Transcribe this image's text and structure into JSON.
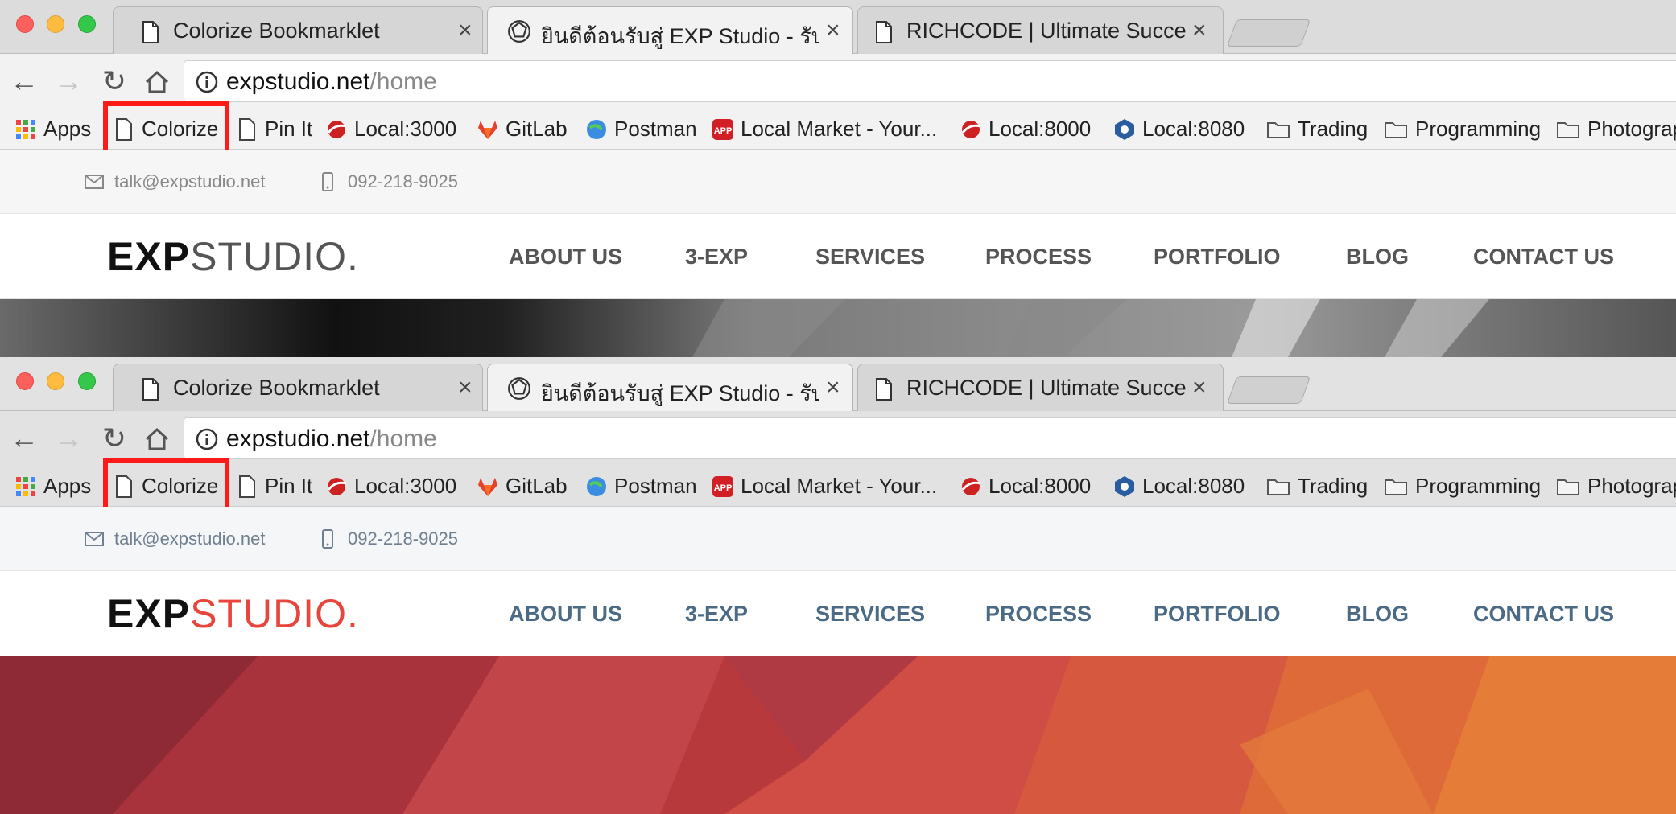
{
  "screens": {
    "a": {
      "tabs": [
        {
          "title": "Colorize Bookmarklet",
          "close": "×"
        },
        {
          "title": "ยินดีต้อนรับสู่ EXP Studio - รับทำเ",
          "close": "×"
        },
        {
          "title": "RICHCODE | Ultimate Success",
          "close": "×"
        }
      ],
      "url": {
        "host": "expstudio.net",
        "path": "/home"
      },
      "bookmarks": [
        {
          "label": "Apps",
          "icon": "apps-grid-icon"
        },
        {
          "label": "Colorize",
          "icon": "page-icon"
        },
        {
          "label": "Pin It",
          "icon": "page-icon"
        },
        {
          "label": "Local:3000",
          "icon": "rails-icon"
        },
        {
          "label": "GitLab",
          "icon": "gitlab-icon"
        },
        {
          "label": "Postman",
          "icon": "postman-icon"
        },
        {
          "label": "Local Market - Your...",
          "icon": "app-icon"
        },
        {
          "label": "Local:8000",
          "icon": "rails-icon"
        },
        {
          "label": "Local:8080",
          "icon": "hexagon-icon"
        },
        {
          "label": "Trading",
          "icon": "folder-icon"
        },
        {
          "label": "Programming",
          "icon": "folder-icon"
        },
        {
          "label": "Photograp",
          "icon": "folder-icon"
        }
      ],
      "contact": {
        "email": "talk@expstudio.net",
        "phone": "092-218-9025"
      },
      "logo": {
        "part1": "EXP",
        "part2": "STUDIO."
      },
      "menu": [
        "ABOUT US",
        "3-EXP",
        "SERVICES",
        "PROCESS",
        "PORTFOLIO",
        "BLOG",
        "CONTACT US"
      ]
    },
    "b": {
      "tabs": [
        {
          "title": "Colorize Bookmarklet",
          "close": "×"
        },
        {
          "title": "ยินดีต้อนรับสู่ EXP Studio - รับทำเ",
          "close": "×"
        },
        {
          "title": "RICHCODE | Ultimate Success",
          "close": "×"
        }
      ],
      "url": {
        "host": "expstudio.net",
        "path": "/home"
      },
      "bookmarks": [
        {
          "label": "Apps",
          "icon": "apps-grid-icon"
        },
        {
          "label": "Colorize",
          "icon": "page-icon"
        },
        {
          "label": "Pin It",
          "icon": "page-icon"
        },
        {
          "label": "Local:3000",
          "icon": "rails-icon"
        },
        {
          "label": "GitLab",
          "icon": "gitlab-icon"
        },
        {
          "label": "Postman",
          "icon": "postman-icon"
        },
        {
          "label": "Local Market - Your...",
          "icon": "app-icon"
        },
        {
          "label": "Local:8000",
          "icon": "rails-icon"
        },
        {
          "label": "Local:8080",
          "icon": "hexagon-icon"
        },
        {
          "label": "Trading",
          "icon": "folder-icon"
        },
        {
          "label": "Programming",
          "icon": "folder-icon"
        },
        {
          "label": "Photograp",
          "icon": "folder-icon"
        }
      ],
      "contact": {
        "email": "talk@expstudio.net",
        "phone": "092-218-9025"
      },
      "logo": {
        "part1": "EXP",
        "part2": "STUDIO."
      },
      "menu": [
        "ABOUT US",
        "3-EXP",
        "SERVICES",
        "PROCESS",
        "PORTFOLIO",
        "BLOG",
        "CONTACT US"
      ]
    }
  },
  "colors": {
    "highlight": "#ff1a1a",
    "grayscale_logo": "#555555",
    "colorized_logo": "#e8453c",
    "colorized_menu": "#4a6a86",
    "hero_red": "#b8393b"
  }
}
